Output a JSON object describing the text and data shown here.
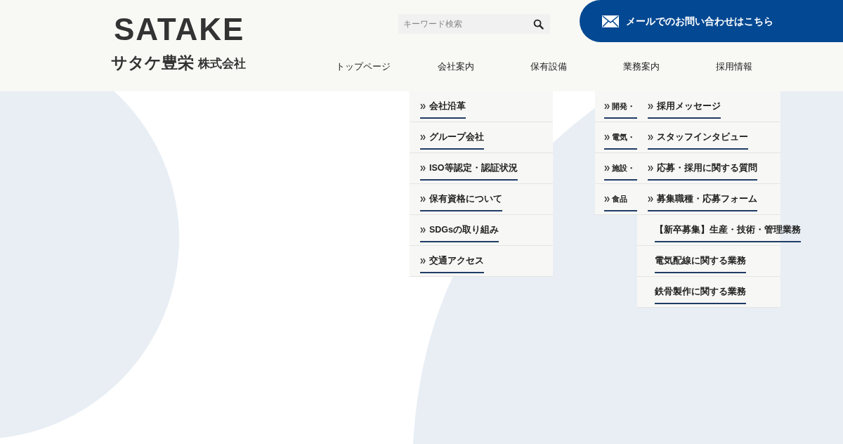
{
  "logo": {
    "wordmark": "SATAKE",
    "name": "サタケ豊栄",
    "suffix": "株式会社"
  },
  "search": {
    "placeholder": "キーワード検索"
  },
  "contact_button": {
    "label": "メールでのお問い合わせはこちら"
  },
  "nav": [
    {
      "label": "トップページ"
    },
    {
      "label": "会社案内"
    },
    {
      "label": "保有設備"
    },
    {
      "label": "業務案内"
    },
    {
      "label": "採用情報"
    }
  ],
  "company_menu": [
    {
      "label": "会社沿革",
      "kind": "link"
    },
    {
      "label": "グループ会社",
      "kind": "link"
    },
    {
      "label": "ISO等認定・認証状況",
      "kind": "link"
    },
    {
      "label": "保有資格について",
      "kind": "link"
    },
    {
      "label": "SDGsの取り組み",
      "kind": "link"
    },
    {
      "label": "交通アクセス",
      "kind": "link"
    }
  ],
  "business_menu": [
    {
      "label": "開発・",
      "kind": "link"
    },
    {
      "label": "電気・",
      "kind": "link"
    },
    {
      "label": "施設・",
      "kind": "link"
    },
    {
      "label": "食品",
      "kind": "link"
    }
  ],
  "recruit_menu": [
    {
      "label": "採用メッセージ",
      "kind": "link"
    },
    {
      "label": "スタッフインタビュー",
      "kind": "link"
    },
    {
      "label": "応募・採用に関する質問",
      "kind": "link"
    },
    {
      "label": "募集職種・応募フォーム",
      "kind": "link"
    },
    {
      "label": "【新卒募集】生産・技術・管理業務",
      "kind": "sublink"
    },
    {
      "label": "電気配線に関する業務",
      "kind": "sublink"
    },
    {
      "label": "鉄骨製作に関する業務",
      "kind": "sublink"
    }
  ]
}
